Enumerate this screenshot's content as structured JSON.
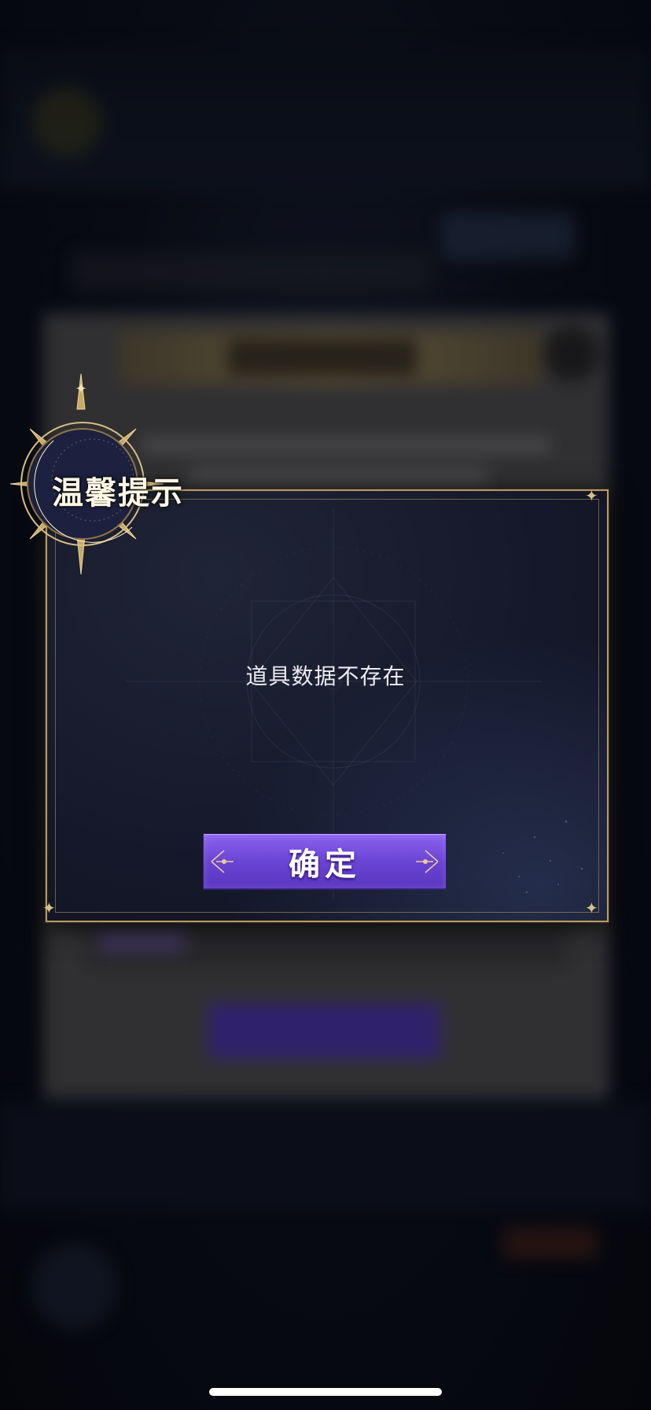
{
  "dialog": {
    "title": "温馨提示",
    "message": "道具数据不存在",
    "confirm_label": "确定"
  },
  "colors": {
    "frame_gold": "#b99a5e",
    "button_purple": "#6a44d4",
    "dialog_bg": "#14182a"
  },
  "icons": {
    "badge": "crescent-moon-sun-emblem",
    "corners": "four-point-star"
  }
}
